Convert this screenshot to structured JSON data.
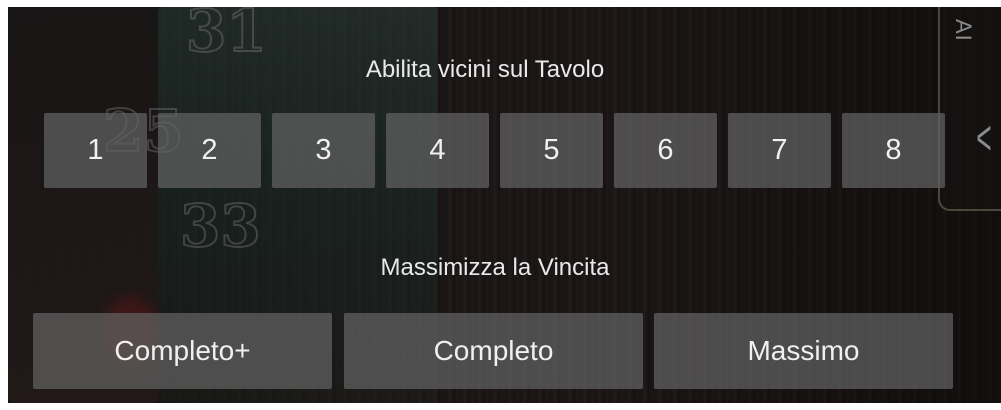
{
  "neighbors": {
    "title": "Abilita vicini sul Tavolo",
    "buttons": [
      "1",
      "2",
      "3",
      "4",
      "5",
      "6",
      "7",
      "8"
    ]
  },
  "maximize": {
    "title": "Massimizza la Vincita",
    "buttons": [
      "Completo+",
      "Completo",
      "Massimo"
    ]
  },
  "side_rail": {
    "label": "AI",
    "icon": "chevron-left-icon"
  },
  "background": {
    "numbers": [
      "31",
      "25",
      "33"
    ]
  }
}
